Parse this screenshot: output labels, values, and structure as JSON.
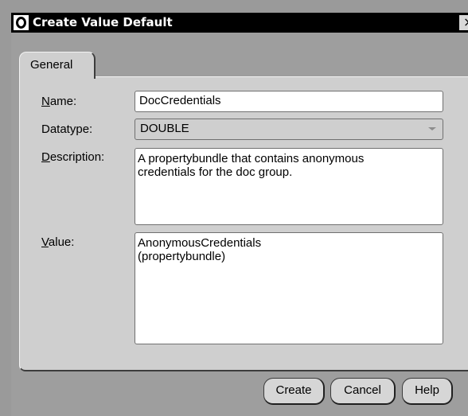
{
  "window": {
    "title": "Create Value Default",
    "close_glyph": "×"
  },
  "tabs": [
    {
      "label": "General",
      "selected": true
    }
  ],
  "form": {
    "name": {
      "label": "Name:",
      "mnemonic": "N",
      "rest": "ame:",
      "value": "DocCredentials"
    },
    "datatype": {
      "label": "Datatype:",
      "value": "DOUBLE"
    },
    "description": {
      "label": "Description:",
      "mnemonic": "D",
      "rest": "escription:",
      "value": "A propertybundle that contains anonymous\ncredentials for the doc group."
    },
    "value": {
      "label": "Value:",
      "mnemonic": "V",
      "rest": "alue:",
      "value": "AnonymousCredentials\n(propertybundle)"
    }
  },
  "buttons": {
    "create": "Create",
    "cancel": "Cancel",
    "help": "Help"
  },
  "colors": {
    "titlebar": "#000000",
    "dialog_background": "#9e9e9e",
    "panel": "#cfcfcf",
    "input_background": "#ffffff"
  },
  "icons": {
    "app_icon": "oracle-o-icon",
    "close_icon": "close-icon",
    "dropdown_icon": "chevron-down-icon"
  }
}
